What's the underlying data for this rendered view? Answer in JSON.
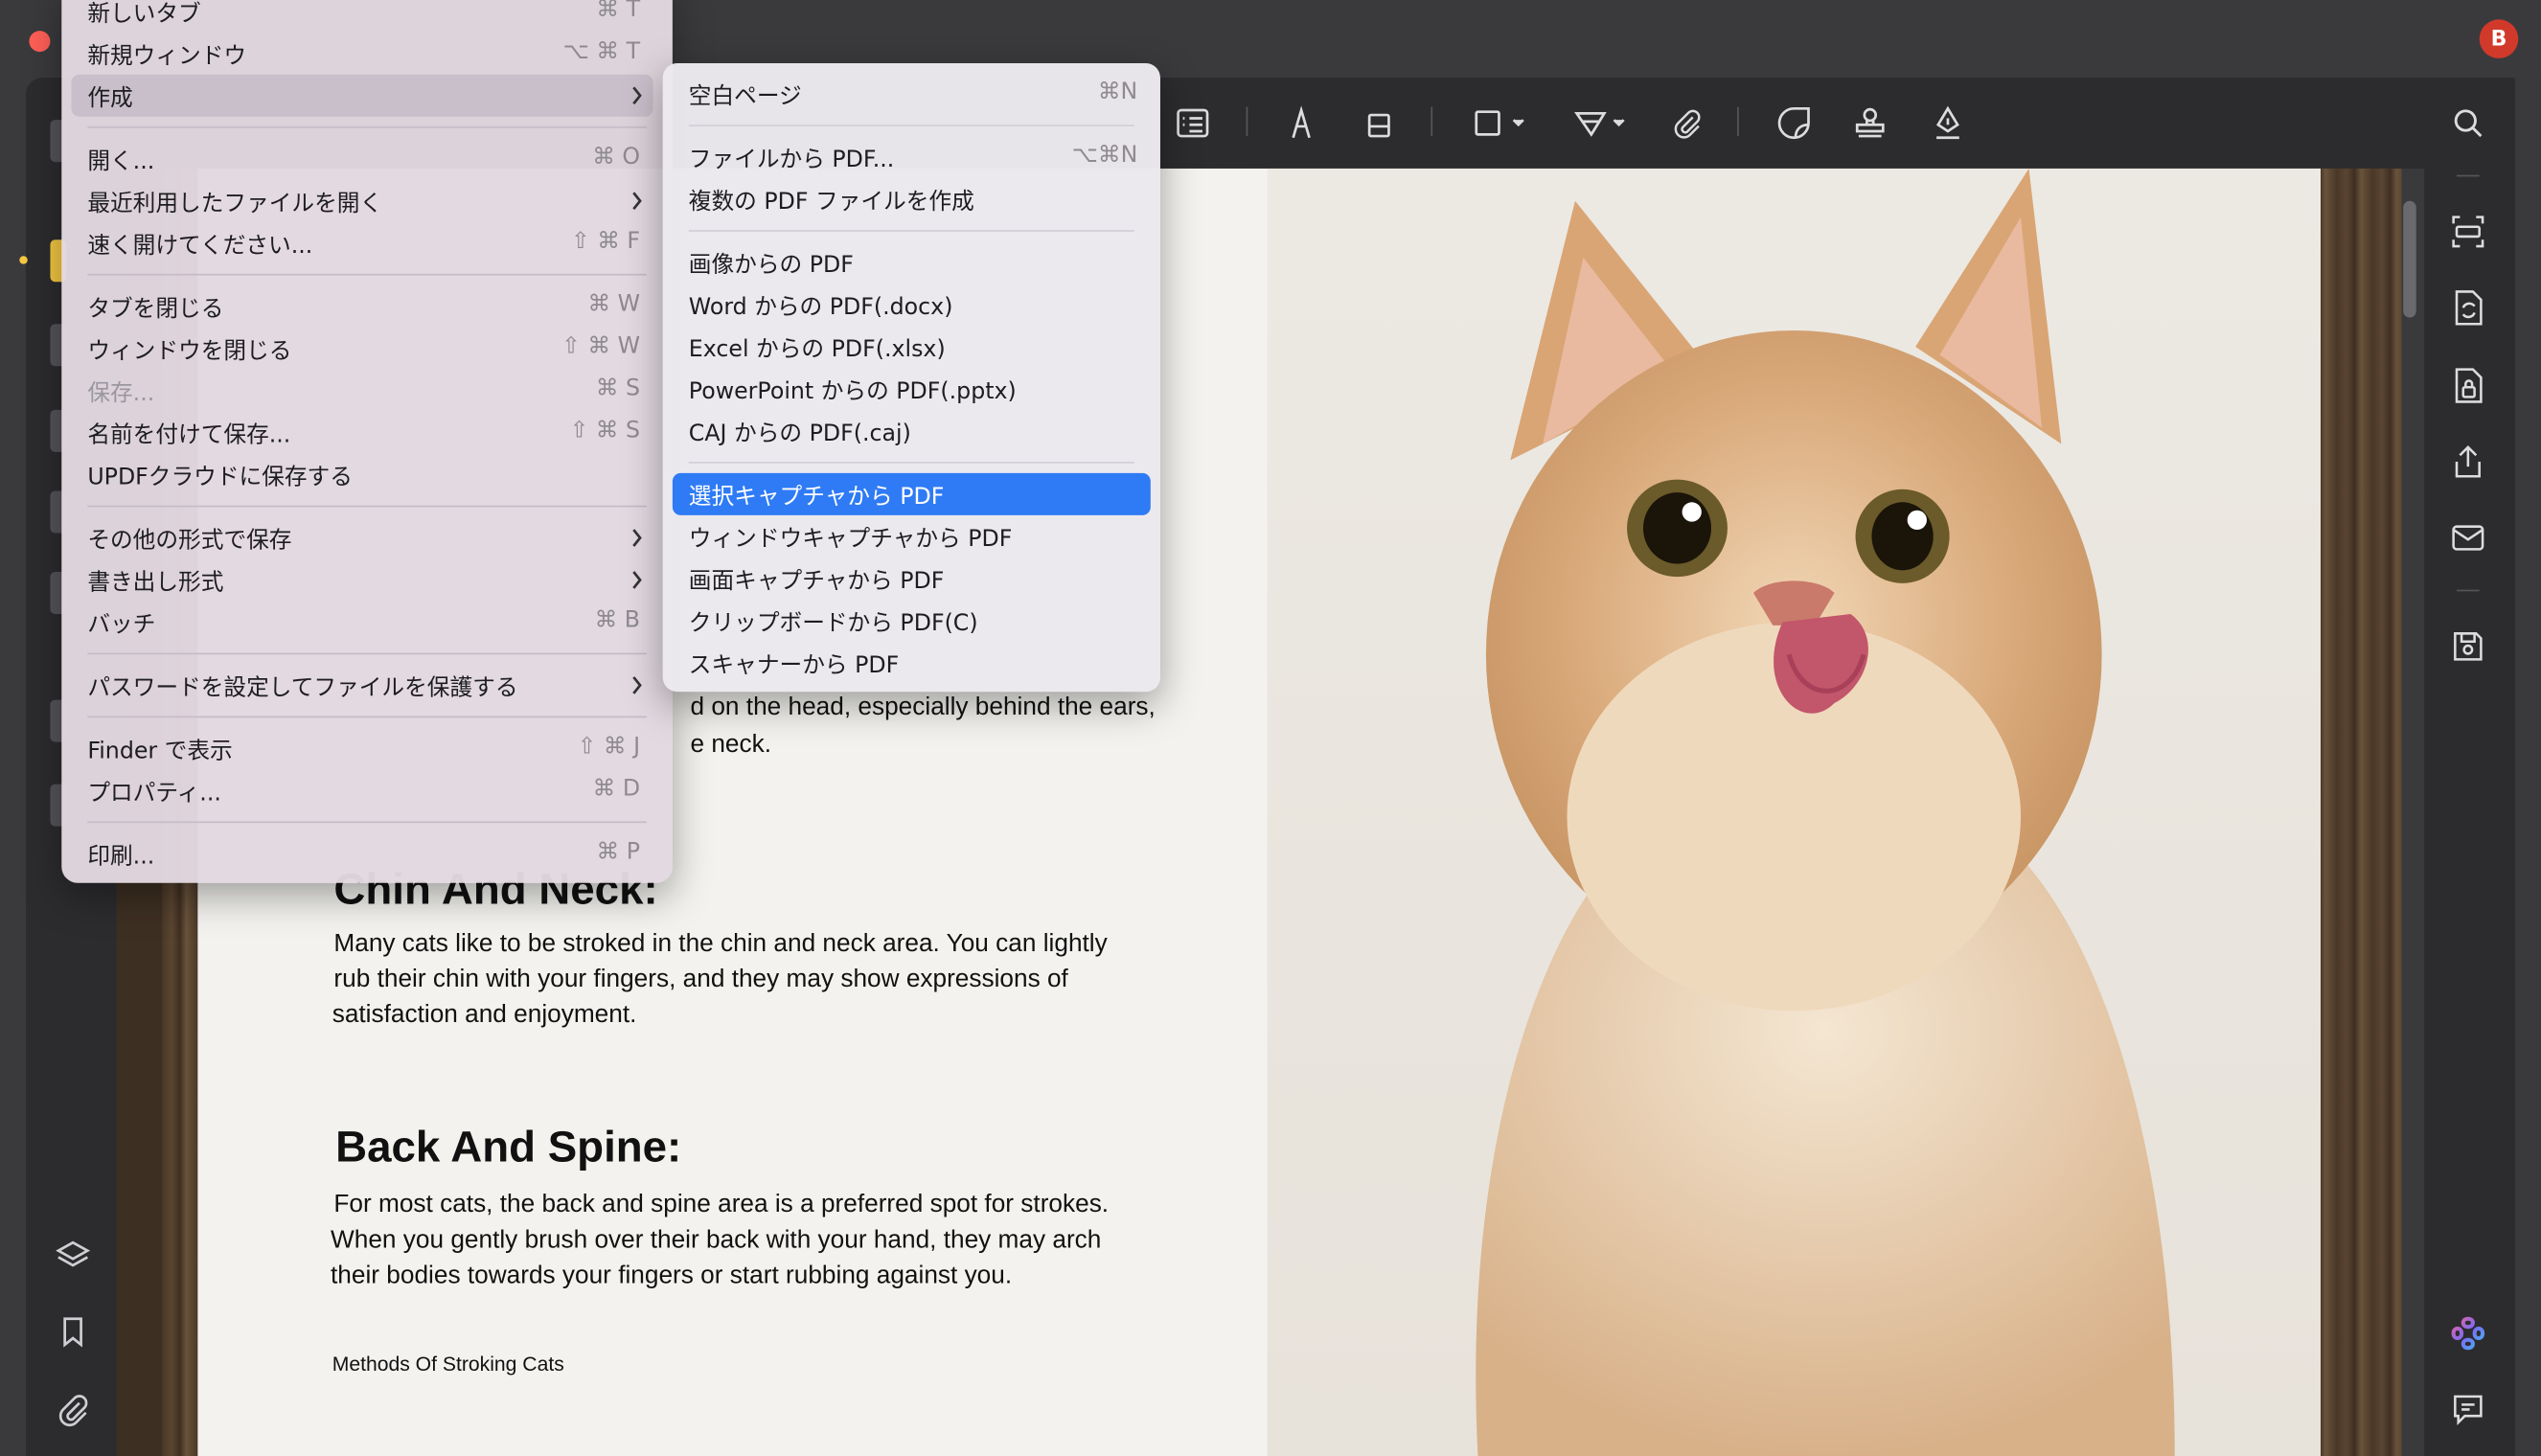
{
  "window": {
    "avatar_initial": "B"
  },
  "file_menu": {
    "items": [
      {
        "label": "新しいタブ",
        "shortcut": "⌘ T"
      },
      {
        "label": "新規ウィンドウ",
        "shortcut": "⌥ ⌘ T"
      },
      {
        "label": "作成",
        "shortcut": ""
      },
      {
        "label": "開く...",
        "shortcut": "⌘ O"
      },
      {
        "label": "最近利用したファイルを開く",
        "shortcut": ""
      },
      {
        "label": "速く開けてください...",
        "shortcut": "⇧ ⌘ F"
      },
      {
        "label": "タブを閉じる",
        "shortcut": "⌘ W"
      },
      {
        "label": "ウィンドウを閉じる",
        "shortcut": "⇧ ⌘ W"
      },
      {
        "label": "保存...",
        "shortcut": "⌘ S"
      },
      {
        "label": "名前を付けて保存...",
        "shortcut": "⇧ ⌘ S"
      },
      {
        "label": "UPDFクラウドに保存する",
        "shortcut": ""
      },
      {
        "label": "その他の形式で保存",
        "shortcut": ""
      },
      {
        "label": "書き出し形式",
        "shortcut": ""
      },
      {
        "label": "バッチ",
        "shortcut": "⌘ B"
      },
      {
        "label": "パスワードを設定してファイルを保護する",
        "shortcut": ""
      },
      {
        "label": "Finder で表示",
        "shortcut": "⇧ ⌘ J"
      },
      {
        "label": "プロパティ...",
        "shortcut": "⌘ D"
      },
      {
        "label": "印刷...",
        "shortcut": "⌘ P"
      }
    ]
  },
  "create_submenu": {
    "items": [
      {
        "label": "空白ページ",
        "shortcut": "⌘N"
      },
      {
        "label": "ファイルから PDF...",
        "shortcut": "⌥⌘N"
      },
      {
        "label": "複数の PDF ファイルを作成",
        "shortcut": ""
      },
      {
        "label": "画像からの PDF",
        "shortcut": ""
      },
      {
        "label": "Word からの PDF(.docx)",
        "shortcut": ""
      },
      {
        "label": "Excel からの PDF(.xlsx)",
        "shortcut": ""
      },
      {
        "label": "PowerPoint からの PDF(.pptx)",
        "shortcut": ""
      },
      {
        "label": "CAJ からの PDF(.caj)",
        "shortcut": ""
      },
      {
        "label": "選択キャプチャから PDF",
        "shortcut": ""
      },
      {
        "label": "ウィンドウキャプチャから PDF",
        "shortcut": ""
      },
      {
        "label": "画面キャプチャから PDF",
        "shortcut": ""
      },
      {
        "label": "クリップボードから PDF(C)",
        "shortcut": ""
      },
      {
        "label": "スキャナーから PDF",
        "shortcut": ""
      }
    ]
  },
  "document": {
    "partial_line1": "d on the head, especially behind the ears,",
    "partial_line2": "e neck.",
    "heading_chin": "Chin And Neck:",
    "para_chin_1": "Many cats like to be stroked in the chin and neck area. You can lightly",
    "para_chin_2": "rub their chin with your fingers, and they may show expressions of",
    "para_chin_3": "satisfaction and enjoyment.",
    "heading_back": "Back And Spine:",
    "para_back_1": "For most cats, the back and spine area is a preferred spot for strokes.",
    "para_back_2": "When you gently brush over their back with your hand, they may arch",
    "para_back_3": "their bodies towards your fingers or start rubbing against you.",
    "footer": "Methods Of Stroking Cats"
  },
  "colors": {
    "accent": "#2f7bf5",
    "close_button": "#ff5f57",
    "avatar": "#d1392b",
    "ai_icon_gradient": [
      "#f0609a",
      "#7b6cf6",
      "#3fb8f0"
    ]
  }
}
